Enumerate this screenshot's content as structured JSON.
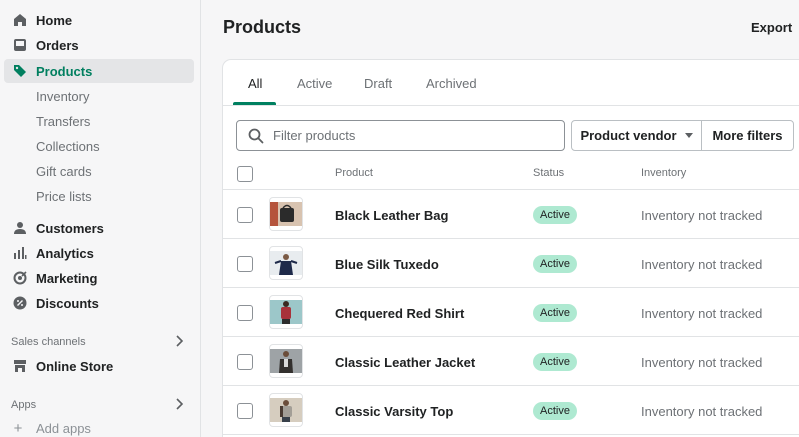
{
  "sidebar": {
    "nav": [
      {
        "label": "Home",
        "icon": "home-icon"
      },
      {
        "label": "Orders",
        "icon": "orders-icon"
      },
      {
        "label": "Products",
        "icon": "tag-icon",
        "active": true
      }
    ],
    "product_subitems": [
      "Inventory",
      "Transfers",
      "Collections",
      "Gift cards",
      "Price lists"
    ],
    "nav2": [
      {
        "label": "Customers",
        "icon": "person-icon"
      },
      {
        "label": "Analytics",
        "icon": "bar-chart-icon"
      },
      {
        "label": "Marketing",
        "icon": "target-icon"
      },
      {
        "label": "Discounts",
        "icon": "discount-icon"
      }
    ],
    "sales_channels_label": "Sales channels",
    "online_store_label": "Online Store",
    "apps_label": "Apps",
    "add_apps_label": "Add apps"
  },
  "header": {
    "title": "Products",
    "export_label": "Export"
  },
  "tabs": [
    "All",
    "Active",
    "Draft",
    "Archived"
  ],
  "filter": {
    "placeholder": "Filter products",
    "vendor_label": "Product vendor",
    "more_filters_label": "More filters"
  },
  "table": {
    "columns": [
      "Product",
      "Status",
      "Inventory"
    ],
    "rows": [
      {
        "name": "Black Leather Bag",
        "status": "Active",
        "inventory": "Inventory not tracked"
      },
      {
        "name": "Blue Silk Tuxedo",
        "status": "Active",
        "inventory": "Inventory not tracked"
      },
      {
        "name": "Chequered Red Shirt",
        "status": "Active",
        "inventory": "Inventory not tracked"
      },
      {
        "name": "Classic Leather Jacket",
        "status": "Active",
        "inventory": "Inventory not tracked"
      },
      {
        "name": "Classic Varsity Top",
        "status": "Active",
        "inventory": "Inventory not tracked"
      }
    ]
  },
  "colors": {
    "accent": "#008060",
    "active_nav_text": "#007f5f",
    "badge_bg": "#aee9d1"
  }
}
